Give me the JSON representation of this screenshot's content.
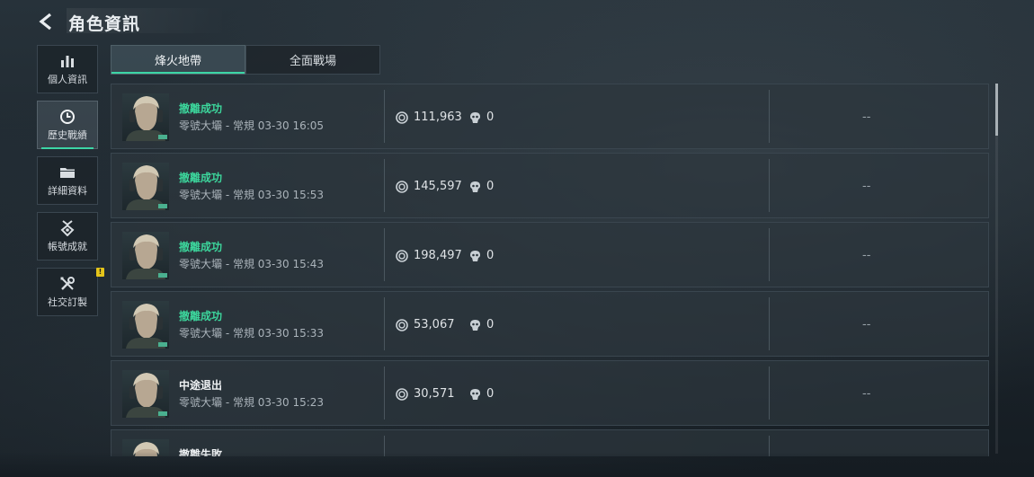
{
  "header": {
    "title": "角色資訊"
  },
  "sidebar": {
    "items": [
      {
        "label": "個人資訊",
        "icon": "bar-chart-icon",
        "active": false
      },
      {
        "label": "歷史戰績",
        "icon": "history-clock-icon",
        "active": true
      },
      {
        "label": "詳細資料",
        "icon": "folder-icon",
        "active": false
      },
      {
        "label": "帳號成就",
        "icon": "medal-icon",
        "active": false
      },
      {
        "label": "社交訂製",
        "icon": "tools-icon",
        "active": false,
        "badge": "!"
      }
    ]
  },
  "tabs": [
    {
      "label": "烽火地帶",
      "active": true
    },
    {
      "label": "全面戰場",
      "active": false
    }
  ],
  "matches": [
    {
      "status": "撤離成功",
      "detail": "零號大壩 - 常規 03-30 16:05",
      "coins": "111,963",
      "kills": "0",
      "extra": "--"
    },
    {
      "status": "撤離成功",
      "detail": "零號大壩 - 常規 03-30 15:53",
      "coins": "145,597",
      "kills": "0",
      "extra": "--"
    },
    {
      "status": "撤離成功",
      "detail": "零號大壩 - 常規 03-30 15:43",
      "coins": "198,497",
      "kills": "0",
      "extra": "--"
    },
    {
      "status": "撤離成功",
      "detail": "零號大壩 - 常規 03-30 15:33",
      "coins": "53,067",
      "kills": "0",
      "extra": "--"
    },
    {
      "status": "中途退出",
      "detail": "零號大壩 - 常規 03-30 15:23",
      "coins": "30,571",
      "kills": "0",
      "extra": "--"
    },
    {
      "status": "撤離失敗",
      "detail": "",
      "coins": "",
      "kills": "",
      "extra": ""
    }
  ],
  "colors": {
    "accent": "#3cd6a6",
    "success": "#3cd69c"
  }
}
